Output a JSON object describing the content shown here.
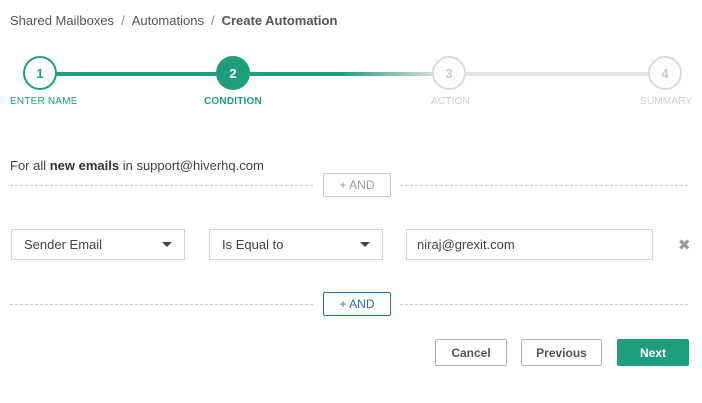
{
  "breadcrumb": {
    "items": [
      "Shared Mailboxes",
      "Automations"
    ],
    "current": "Create Automation",
    "separator": "/"
  },
  "stepper": {
    "active_step": 2,
    "accent": "#1e9e7c",
    "steps": [
      {
        "number": "1",
        "label": "ENTER NAME",
        "state": "done"
      },
      {
        "number": "2",
        "label": "CONDITION",
        "state": "active"
      },
      {
        "number": "3",
        "label": "ACTION",
        "state": "todo"
      },
      {
        "number": "4",
        "label": "SUMMARY",
        "state": "todo"
      }
    ]
  },
  "condition": {
    "intro_prefix": "For all ",
    "intro_bold": "new emails",
    "intro_suffix": " in support@hiverhq.com",
    "and_label": "+ AND",
    "rule": {
      "field": "Sender Email",
      "operator": "Is Equal to",
      "value": "niraj@grexit.com",
      "remove_icon": "close-icon",
      "remove_glyph": "✖"
    }
  },
  "footer": {
    "cancel_label": "Cancel",
    "previous_label": "Previous",
    "next_label": "Next"
  }
}
